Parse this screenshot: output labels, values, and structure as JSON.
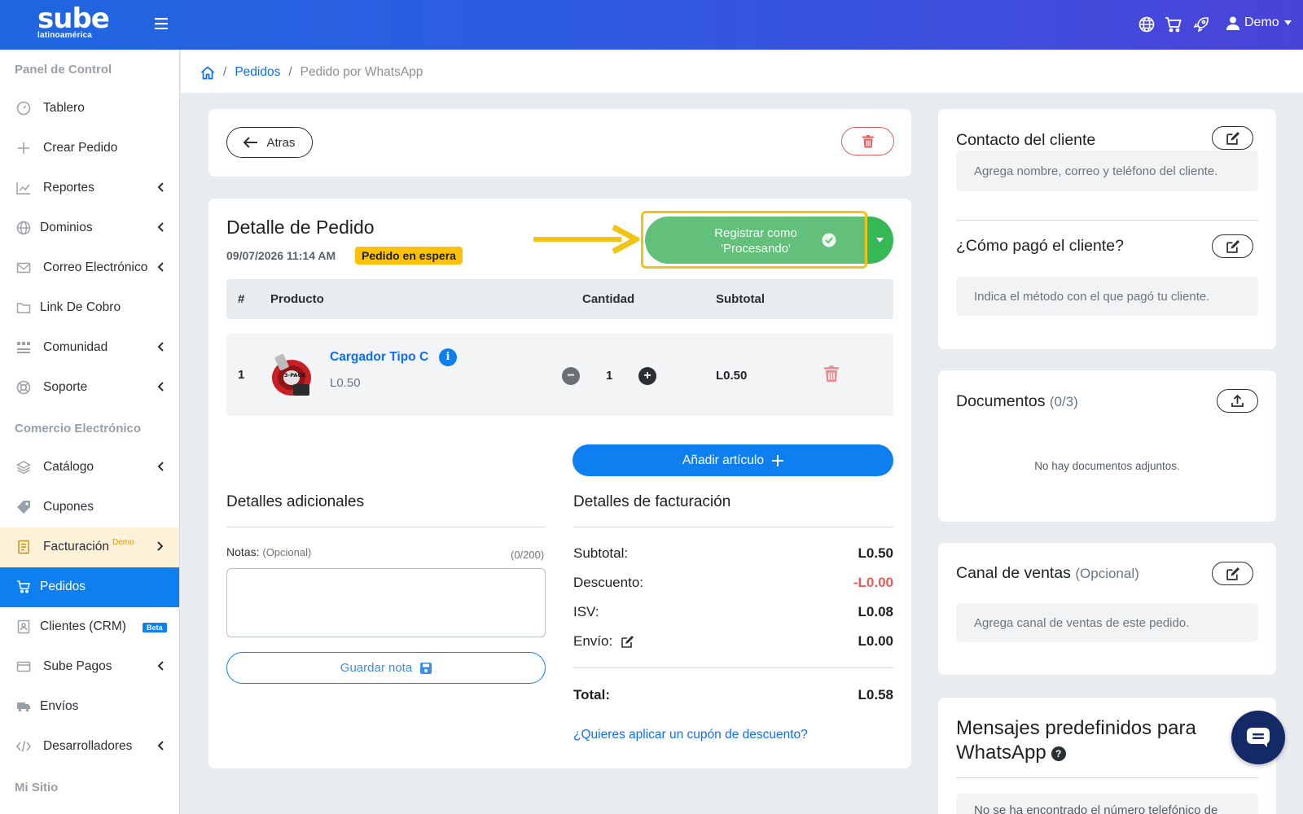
{
  "app": {
    "brand": "sube",
    "brand_sub": "latinoamérica",
    "user_name": "Demo"
  },
  "sidebar": {
    "sections": [
      {
        "label": "Panel de Control"
      },
      {
        "label": "Comercio Electrónico"
      },
      {
        "label": "Mi Sitio"
      }
    ],
    "items": [
      {
        "label": "Tablero",
        "icon": "gauge-icon"
      },
      {
        "label": "Crear Pedido",
        "icon": "plus-icon"
      },
      {
        "label": "Reportes",
        "icon": "chart-line-icon"
      },
      {
        "label": "Dominios",
        "icon": "globe-icon"
      },
      {
        "label": "Correo Electrónico",
        "icon": "envelope-icon"
      },
      {
        "label": "Link De Cobro",
        "icon": "folder-icon"
      },
      {
        "label": "Comunidad",
        "icon": "users-icon"
      },
      {
        "label": "Soporte",
        "icon": "life-ring-icon"
      },
      {
        "label": "Catálogo",
        "icon": "layers-icon"
      },
      {
        "label": "Cupones",
        "icon": "tag-icon"
      },
      {
        "label": "Facturación",
        "tag": "Demo",
        "icon": "receipt-icon"
      },
      {
        "label": "Pedidos",
        "icon": "cart-icon"
      },
      {
        "label": "Clientes (CRM)",
        "tag": "Beta",
        "icon": "id-card-icon"
      },
      {
        "label": "Sube Pagos",
        "icon": "credit-card-icon"
      },
      {
        "label": "Envíos",
        "icon": "truck-icon"
      },
      {
        "label": "Desarrolladores",
        "icon": "code-icon"
      }
    ]
  },
  "breadcrumb": {
    "link": "Pedidos",
    "current": "Pedido por WhatsApp"
  },
  "top_card": {
    "back_label": "Atras"
  },
  "order": {
    "title": "Detalle de Pedido",
    "date": "09/07/2026 11:14 AM",
    "status": "Pedido en espera",
    "register_line1": "Registrar como",
    "register_line2": "'Procesando'",
    "columns": [
      "#",
      "Producto",
      "Cantidad",
      "Subtotal"
    ],
    "items": [
      {
        "num": "1",
        "name": "Cargador Tipo C",
        "price": "L0.50",
        "qty": "1",
        "subtotal": "L0.50",
        "image_text": "3-PACK"
      }
    ],
    "add_item_label": "Añadir artículo"
  },
  "additional": {
    "title": "Detalles adicionales",
    "notes_label": "Notas:",
    "notes_optional": "(Opcional)",
    "notes_count": "(0/200)",
    "notes_value": "",
    "save_label": "Guardar nota"
  },
  "billing": {
    "title": "Detalles de facturación",
    "subtotal_label": "Subtotal:",
    "subtotal": "L0.50",
    "discount_label": "Descuento:",
    "discount": "-L0.00",
    "tax_label": "ISV:",
    "tax": "L0.08",
    "shipping_label": "Envío:",
    "shipping": "L0.00",
    "total_label": "Total:",
    "total": "L0.58",
    "coupon_link": "¿Quieres aplicar un cupón de descuento?"
  },
  "contact": {
    "title": "Contacto del cliente",
    "placeholder": "Agrega nombre, correo y teléfono del cliente.",
    "payment_title": "¿Cómo pagó el cliente?",
    "payment_placeholder": "Indica el método con el que pagó tu cliente."
  },
  "documents": {
    "title": "Documentos",
    "count": "(0/3)",
    "empty": "No hay documentos adjuntos."
  },
  "channel": {
    "title": "Canal de ventas",
    "optional": "(Opcional)",
    "placeholder": "Agrega canal de ventas de este pedido."
  },
  "whatsapp": {
    "title_line1": "Mensajes predefinidos para",
    "title_line2": "WhatsApp",
    "partial_text": "No se ha encontrado el número telefónico de"
  },
  "colors": {
    "primary": "#0d7ff0",
    "success": "#63c07a",
    "warning": "#ffc107",
    "danger": "#e35d5d",
    "highlight": "#f2c315"
  }
}
